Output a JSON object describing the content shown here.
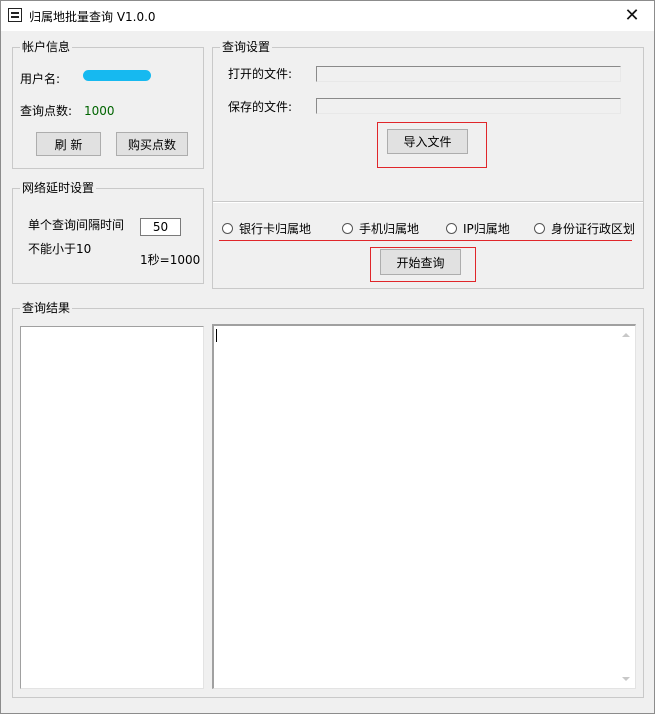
{
  "window": {
    "title": "归属地批量查询 V1.0.0",
    "close_glyph": "✕"
  },
  "account": {
    "legend": "帐户信息",
    "username_label": "用户名:",
    "username_value_redacted": true,
    "points_label": "查询点数:",
    "points_value": "1000",
    "refresh_label": "刷 新",
    "buy_label": "购买点数"
  },
  "delay": {
    "legend": "网络延时设置",
    "interval_label": "单个查询间隔时间",
    "interval_value": "50",
    "min_note": "不能小于10",
    "unit_note": "1秒=1000"
  },
  "settings": {
    "legend": "查询设置",
    "open_file_label": "打开的文件:",
    "open_file_value": "",
    "save_file_label": "保存的文件:",
    "save_file_value": "",
    "import_label": "导入文件",
    "radios": [
      {
        "label": "银行卡归属地",
        "checked": false
      },
      {
        "label": "手机归属地",
        "checked": false
      },
      {
        "label": "IP归属地",
        "checked": false
      },
      {
        "label": "身份证行政区划",
        "checked": false
      }
    ],
    "start_label": "开始查询"
  },
  "results": {
    "legend": "查询结果",
    "list_items": [],
    "output_text": ""
  },
  "colors": {
    "highlight_red": "#e0262a",
    "points_green": "#006400",
    "redaction_blue": "#16b9f0"
  }
}
